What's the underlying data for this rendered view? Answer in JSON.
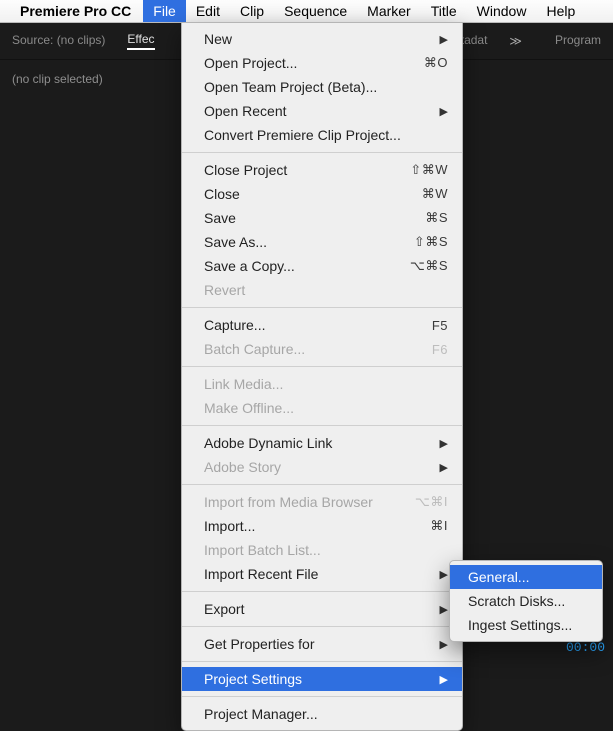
{
  "menubar": {
    "app": "Premiere Pro CC",
    "items": [
      "File",
      "Edit",
      "Clip",
      "Sequence",
      "Marker",
      "Title",
      "Window",
      "Help"
    ],
    "active": 0
  },
  "topbar": {
    "source": "Source: (no clips)",
    "tabs": [
      "Effec",
      "Metadat",
      "Program"
    ],
    "chev": "≫"
  },
  "panel": {
    "noclip": "(no clip selected)",
    "timecode": "00:00"
  },
  "submenu": {
    "items": [
      {
        "l": "General...",
        "hl": true
      },
      {
        "l": "Scratch Disks..."
      },
      {
        "l": "Ingest Settings..."
      }
    ]
  },
  "glyph": {
    "arrow": "▶"
  },
  "menu": {
    "groups": [
      [
        {
          "l": "New",
          "sub": true
        },
        {
          "l": "Open Project...",
          "sc": "⌘O"
        },
        {
          "l": "Open Team Project (Beta)..."
        },
        {
          "l": "Open Recent",
          "sub": true
        },
        {
          "l": "Convert Premiere Clip Project..."
        }
      ],
      [
        {
          "l": "Close Project",
          "sc": "⇧⌘W"
        },
        {
          "l": "Close",
          "sc": "⌘W"
        },
        {
          "l": "Save",
          "sc": "⌘S"
        },
        {
          "l": "Save As...",
          "sc": "⇧⌘S"
        },
        {
          "l": "Save a Copy...",
          "sc": "⌥⌘S"
        },
        {
          "l": "Revert",
          "dis": true
        }
      ],
      [
        {
          "l": "Capture...",
          "sc": "F5"
        },
        {
          "l": "Batch Capture...",
          "sc": "F6",
          "dis": true
        }
      ],
      [
        {
          "l": "Link Media...",
          "dis": true
        },
        {
          "l": "Make Offline...",
          "dis": true
        }
      ],
      [
        {
          "l": "Adobe Dynamic Link",
          "sub": true
        },
        {
          "l": "Adobe Story",
          "sub": true,
          "dis": true
        }
      ],
      [
        {
          "l": "Import from Media Browser",
          "sc": "⌥⌘I",
          "dis": true
        },
        {
          "l": "Import...",
          "sc": "⌘I"
        },
        {
          "l": "Import Batch List...",
          "dis": true
        },
        {
          "l": "Import Recent File",
          "sub": true
        }
      ],
      [
        {
          "l": "Export",
          "sub": true
        }
      ],
      [
        {
          "l": "Get Properties for",
          "sub": true
        }
      ],
      [
        {
          "l": "Project Settings",
          "sub": true,
          "hl": true
        }
      ],
      [
        {
          "l": "Project Manager..."
        }
      ]
    ]
  }
}
